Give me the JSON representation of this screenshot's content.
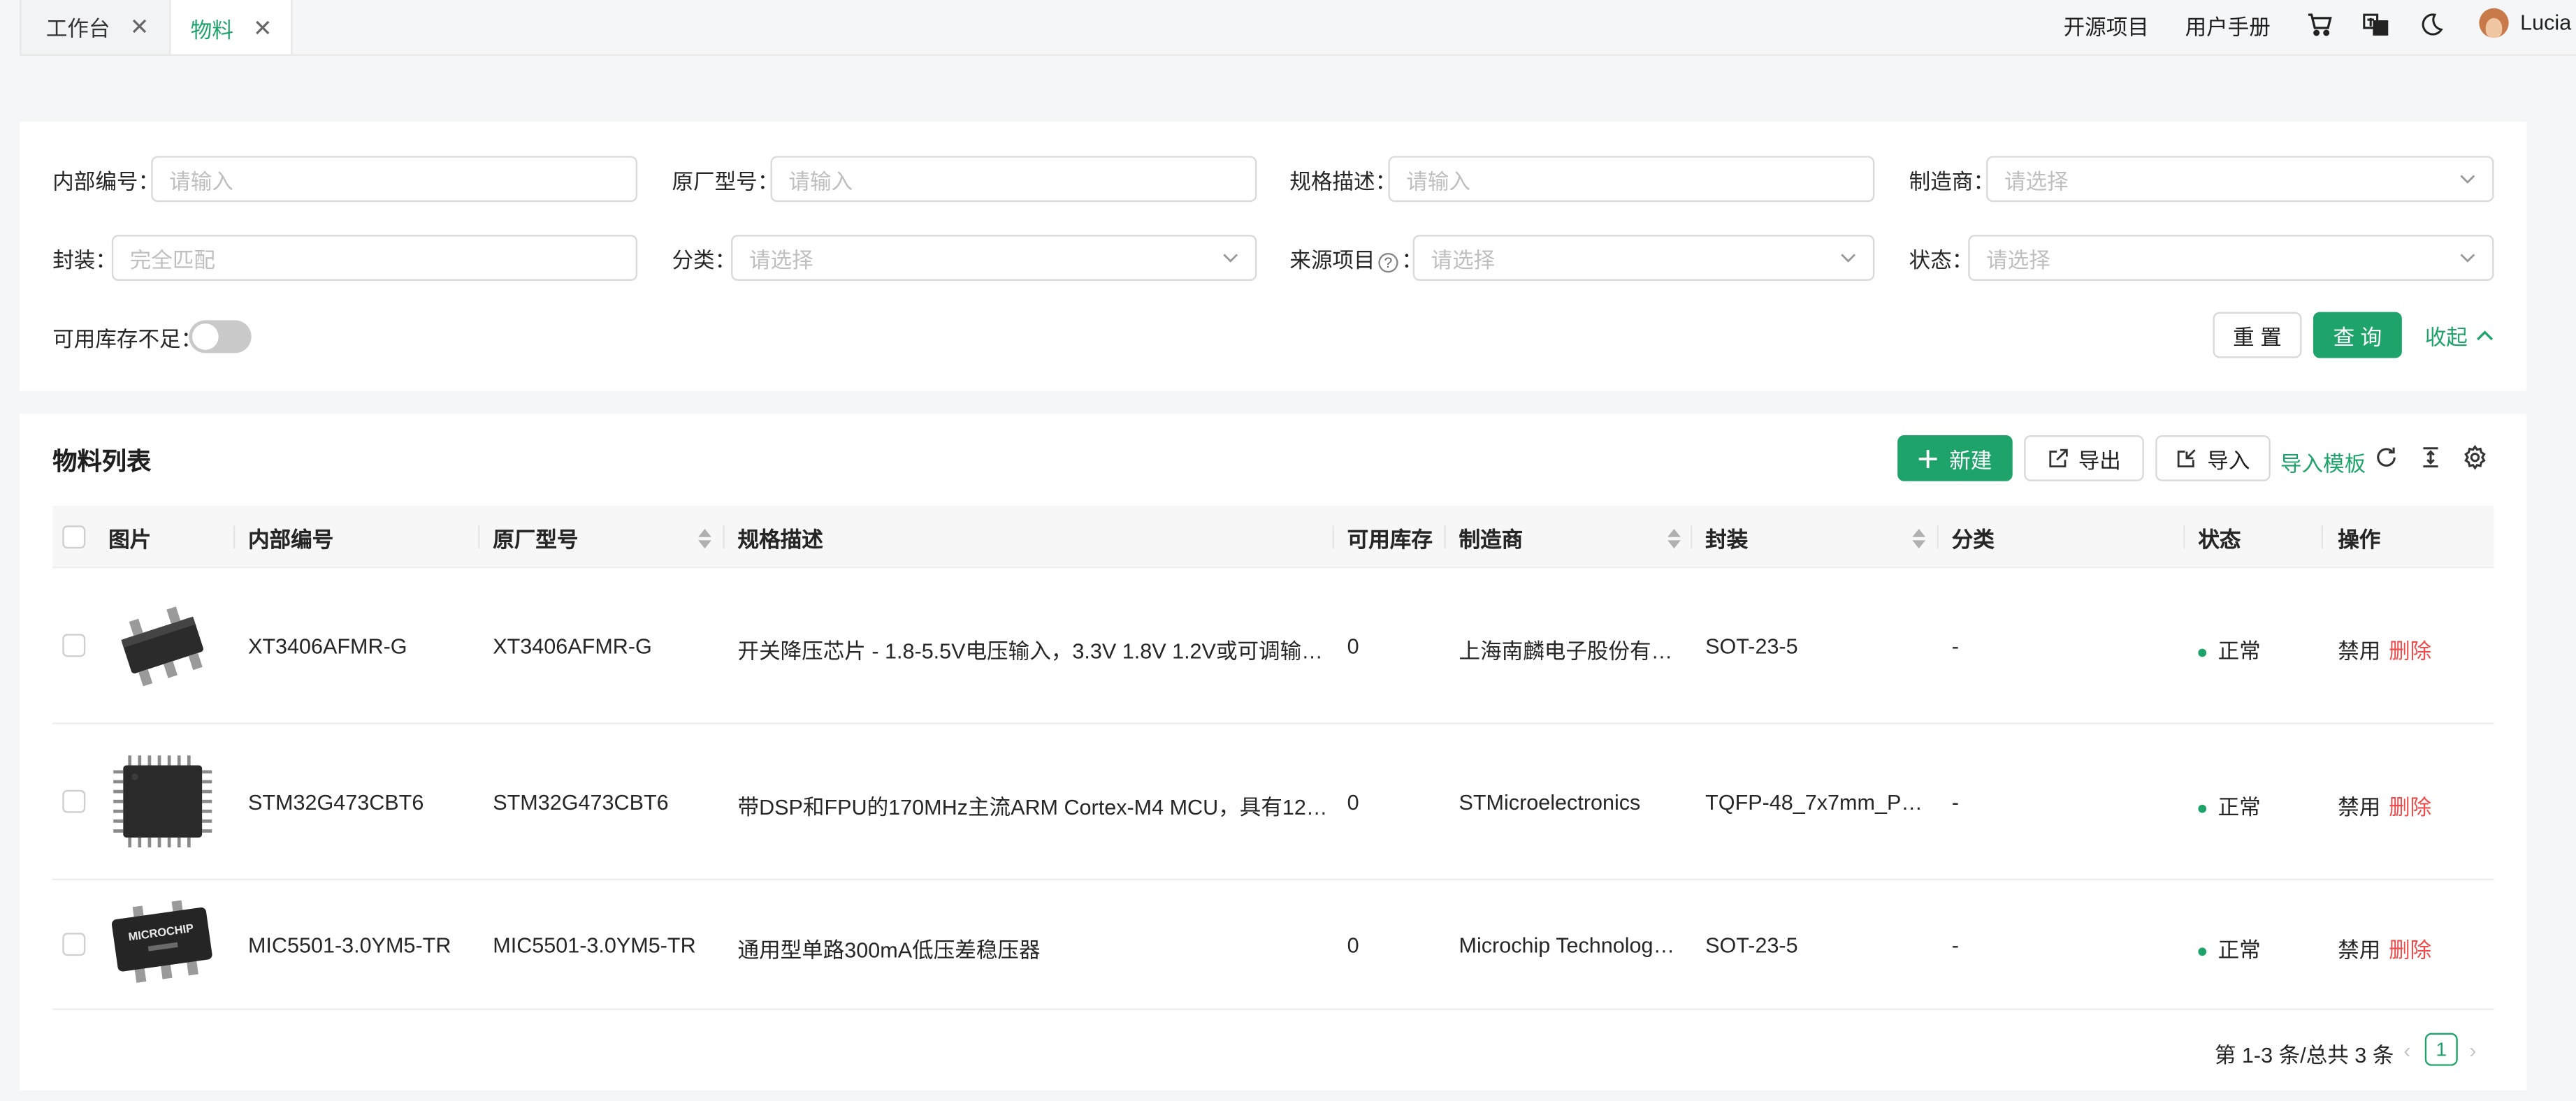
{
  "tabs": [
    {
      "label": "工作台",
      "active": false
    },
    {
      "label": "物料",
      "active": true
    }
  ],
  "header": {
    "links": [
      "开源项目",
      "用户手册"
    ],
    "icons": [
      "cart-icon",
      "translate-icon",
      "moon-icon"
    ],
    "user": "Lucia"
  },
  "filters": {
    "internal_no": {
      "label": "内部编号",
      "placeholder": "请输入"
    },
    "mfr_model": {
      "label": "原厂型号",
      "placeholder": "请输入"
    },
    "spec": {
      "label": "规格描述",
      "placeholder": "请输入"
    },
    "manufacturer": {
      "label": "制造商",
      "placeholder": "请选择"
    },
    "package": {
      "label": "封装",
      "placeholder": "完全匹配"
    },
    "category": {
      "label": "分类",
      "placeholder": "请选择"
    },
    "source_project": {
      "label": "来源项目",
      "placeholder": "请选择"
    },
    "status": {
      "label": "状态",
      "placeholder": "请选择"
    },
    "low_stock": {
      "label": "可用库存不足",
      "enabled": false
    },
    "reset_label": "重 置",
    "query_label": "查 询",
    "collapse_label": "收起"
  },
  "list": {
    "title": "物料列表",
    "new_label": "新建",
    "export_label": "导出",
    "import_label": "导入",
    "template_label": "导入模板",
    "columns": [
      "图片",
      "内部编号",
      "原厂型号",
      "规格描述",
      "可用库存",
      "制造商",
      "封装",
      "分类",
      "状态",
      "操作"
    ],
    "rows": [
      {
        "internal_no": "XT3406AFMR-G",
        "mfr_model": "XT3406AFMR-G",
        "spec": "开关降压芯片 - 1.8-5.5V电压输入，3.3V 1.8V 1.2V或可调输出，...",
        "stock": "0",
        "manufacturer": "上海南麟电子股份有限...",
        "package": "SOT-23-5",
        "category": "-",
        "status": "正常",
        "action_disable": "禁用",
        "action_delete": "删除",
        "image_text": ""
      },
      {
        "internal_no": "STM32G473CBT6",
        "mfr_model": "STM32G473CBT6",
        "spec": "带DSP和FPU的170MHz主流ARM Cortex-M4 MCU，具有128 KB ...",
        "stock": "0",
        "manufacturer": "STMicroelectronics",
        "package": "TQFP-48_7x7mm_P0....",
        "category": "-",
        "status": "正常",
        "action_disable": "禁用",
        "action_delete": "删除",
        "image_text": ""
      },
      {
        "internal_no": "MIC5501-3.0YM5-TR",
        "mfr_model": "MIC5501-3.0YM5-TR",
        "spec": "通用型单路300mA低压差稳压器",
        "stock": "0",
        "manufacturer": "Microchip Technology ...",
        "package": "SOT-23-5",
        "category": "-",
        "status": "正常",
        "action_disable": "禁用",
        "action_delete": "删除",
        "image_text": "MICROCHIP"
      }
    ]
  },
  "pagination": {
    "summary": "第 1-3 条/总共 3 条",
    "current_page": "1"
  },
  "colors": {
    "accent": "#1ea46a",
    "danger": "#f04a4a"
  }
}
